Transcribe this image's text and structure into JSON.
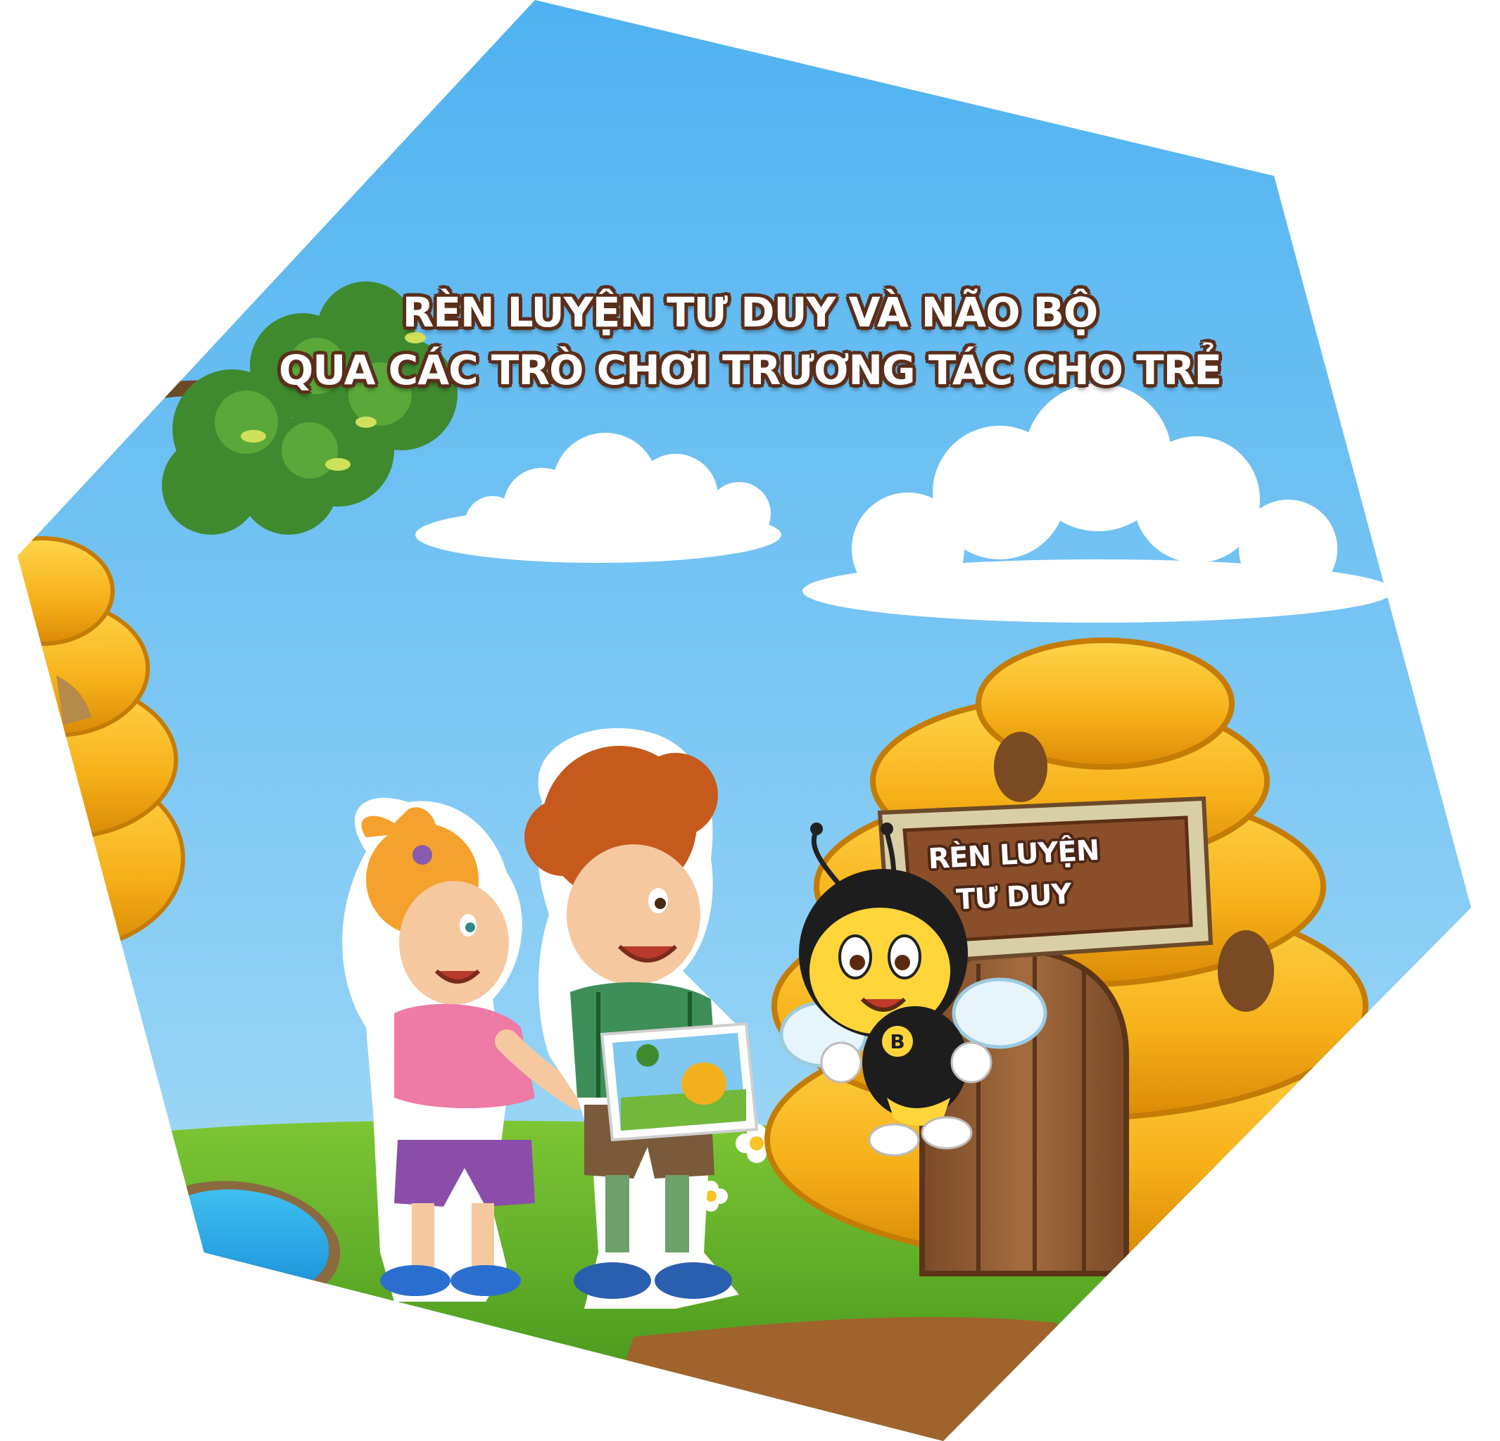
{
  "headline": {
    "line1": "RÈN LUYỆN TƯ DUY VÀ NÃO BỘ",
    "line2": "QUA CÁC TRÒ CHƠI TRƯƠNG TÁC CHO TRẺ"
  },
  "sign": {
    "line1": "RÈN LUYỆN",
    "line2": "TƯ DUY"
  },
  "mascot": {
    "badge_letter": "B"
  },
  "icons": [
    "bee-mascot",
    "girl-character",
    "boy-character",
    "tablet",
    "beehive",
    "tree-branch",
    "cloud",
    "pond",
    "daisy"
  ],
  "colors": {
    "sky_top": "#5bb8f2",
    "sky_bottom": "#a9dcf6",
    "grass": "#6fbb2c",
    "honey": "#f7b51b",
    "wood": "#8a5a35",
    "title_outline": "#5a2e1b"
  }
}
